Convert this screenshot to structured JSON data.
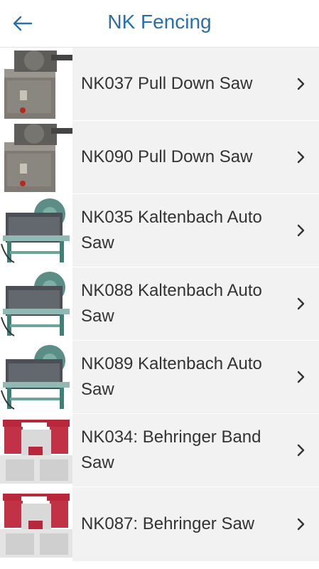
{
  "header": {
    "title": "NK Fencing",
    "back_icon": "arrow-left-icon"
  },
  "items": [
    {
      "label": "NK037 Pull Down Saw",
      "thumb": "pull-down-saw"
    },
    {
      "label": "NK090 Pull Down Saw",
      "thumb": "pull-down-saw"
    },
    {
      "label": "NK035 Kaltenbach Auto Saw",
      "thumb": "kaltenbach-saw"
    },
    {
      "label": "NK088 Kaltenbach Auto Saw",
      "thumb": "kaltenbach-saw"
    },
    {
      "label": "NK089 Kaltenbach Auto Saw",
      "thumb": "kaltenbach-saw"
    },
    {
      "label": "NK034: Behringer Band Saw",
      "thumb": "behringer-saw"
    },
    {
      "label": "NK087: Behringer Saw",
      "thumb": "behringer-saw"
    }
  ],
  "colors": {
    "title": "#2a6fa8",
    "row_bg": "#f2f2f2",
    "text": "#333333"
  }
}
